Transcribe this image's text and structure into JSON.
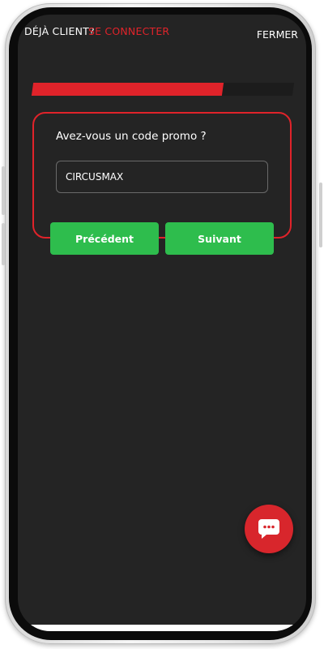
{
  "header": {
    "already_client": "DÉJÀ CLIENT?",
    "login_link": "SE CONNECTER",
    "close": "FERMER"
  },
  "progress": {
    "fraction": 0.73
  },
  "promo": {
    "question": "Avez-vous un code promo ?",
    "code_value": "CIRCUSMAX"
  },
  "nav": {
    "previous": "Précédent",
    "next": "Suivant"
  },
  "chat": {
    "icon": "chat-bubble-icon"
  },
  "colors": {
    "accent": "#e0232a",
    "button": "#2ebd4d",
    "background": "#242424"
  }
}
